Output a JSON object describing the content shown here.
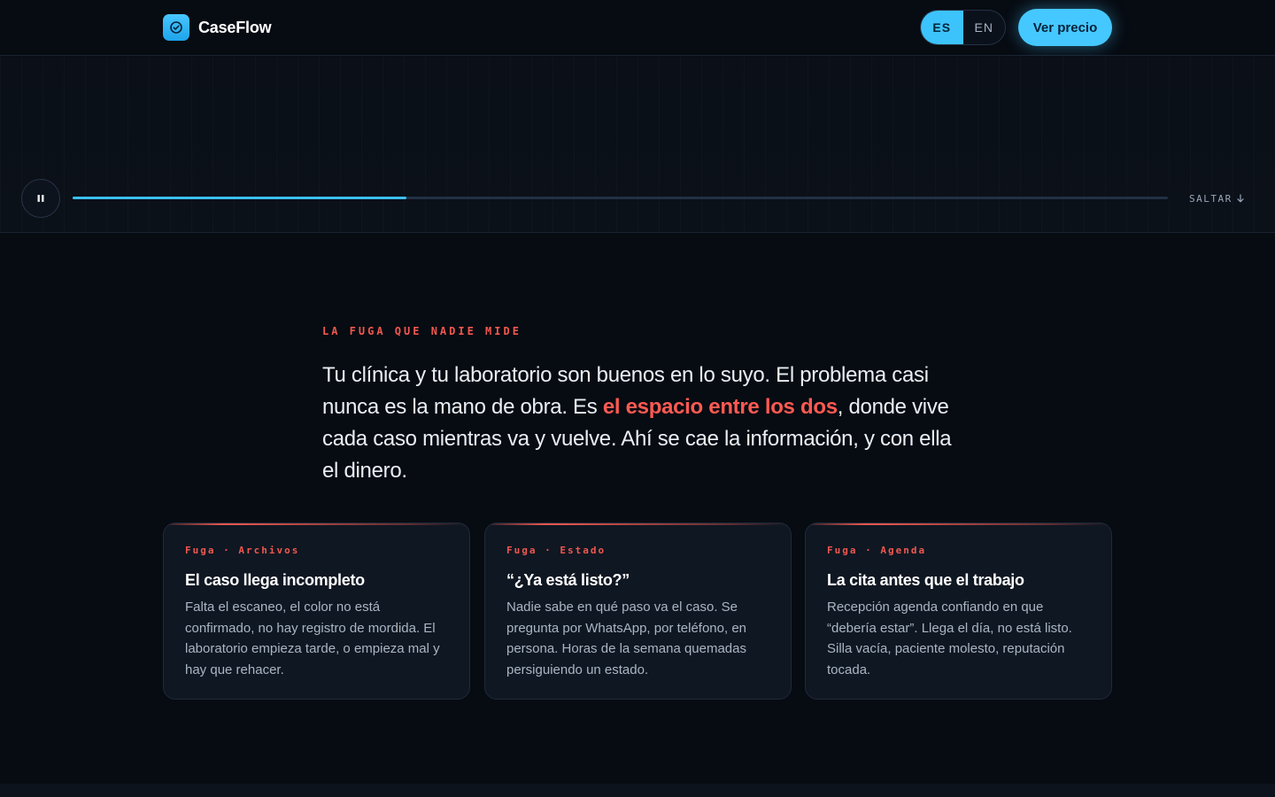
{
  "header": {
    "brand_name": "CaseFlow",
    "lang": {
      "es": "ES",
      "en": "EN",
      "active": "ES"
    },
    "cta_label": "Ver precio"
  },
  "player": {
    "progress": 0.305,
    "skip_label": "SALTAR"
  },
  "section": {
    "eyebrow": "LA FUGA QUE NADIE MIDE",
    "lead_part1": "Tu clínica y tu laboratorio son buenos en lo suyo. El problema casi nunca es la mano de obra. Es ",
    "lead_highlight": "el espacio entre los dos",
    "lead_part2": ", donde vive cada caso mientras va y vuelve. Ahí se cae la información, y con ella el dinero."
  },
  "cards": [
    {
      "tag": "Fuga · Archivos",
      "title": "El caso llega incompleto",
      "body": "Falta el escaneo, el color no está confirmado, no hay registro de mordida. El laboratorio empieza tarde, o empieza mal y hay que rehacer."
    },
    {
      "tag": "Fuga · Estado",
      "title": "“¿Ya está listo?”",
      "body": "Nadie sabe en qué paso va el caso. Se pregunta por WhatsApp, por teléfono, en persona. Horas de la semana quemadas persiguiendo un estado."
    },
    {
      "tag": "Fuga · Agenda",
      "title": "La cita antes que el trabajo",
      "body": "Recepción agenda confiando en que “debería estar”. Llega el día, no está listo. Silla vacía, paciente molesto, reputación tocada."
    }
  ],
  "colors": {
    "accent_blue": "#45c8ff",
    "accent_red": "#f0584f",
    "background": "#070b12"
  },
  "icons": {
    "brand": "check-circle-icon",
    "pause": "pause-icon",
    "skip": "arrow-down-icon"
  }
}
